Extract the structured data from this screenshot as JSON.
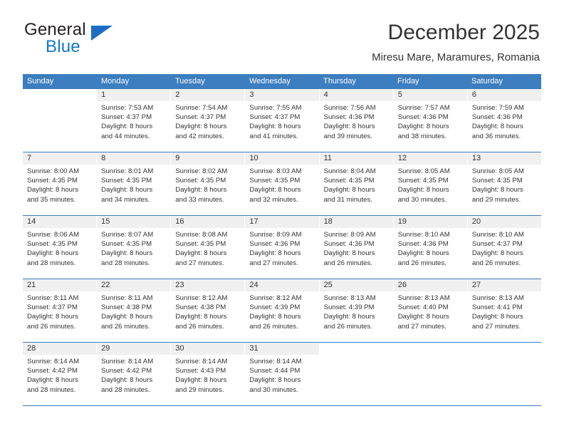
{
  "brand": {
    "line1": "General",
    "line2": "Blue",
    "triangle_icon": "triangle-icon",
    "accent_color": "#1b6ec2"
  },
  "header": {
    "title": "December 2025",
    "subtitle": "Miresu Mare, Maramures, Romania"
  },
  "calendar": {
    "header_color": "#3c7ebf",
    "daynum_bg": "#f0f0f0",
    "day_headers": [
      "Sunday",
      "Monday",
      "Tuesday",
      "Wednesday",
      "Thursday",
      "Friday",
      "Saturday"
    ],
    "weeks": [
      [
        {
          "day": "",
          "lines": []
        },
        {
          "day": "1",
          "lines": [
            "Sunrise: 7:53 AM",
            "Sunset: 4:37 PM",
            "Daylight: 8 hours",
            "and 44 minutes."
          ]
        },
        {
          "day": "2",
          "lines": [
            "Sunrise: 7:54 AM",
            "Sunset: 4:37 PM",
            "Daylight: 8 hours",
            "and 42 minutes."
          ]
        },
        {
          "day": "3",
          "lines": [
            "Sunrise: 7:55 AM",
            "Sunset: 4:37 PM",
            "Daylight: 8 hours",
            "and 41 minutes."
          ]
        },
        {
          "day": "4",
          "lines": [
            "Sunrise: 7:56 AM",
            "Sunset: 4:36 PM",
            "Daylight: 8 hours",
            "and 39 minutes."
          ]
        },
        {
          "day": "5",
          "lines": [
            "Sunrise: 7:57 AM",
            "Sunset: 4:36 PM",
            "Daylight: 8 hours",
            "and 38 minutes."
          ]
        },
        {
          "day": "6",
          "lines": [
            "Sunrise: 7:59 AM",
            "Sunset: 4:36 PM",
            "Daylight: 8 hours",
            "and 36 minutes."
          ]
        }
      ],
      [
        {
          "day": "7",
          "lines": [
            "Sunrise: 8:00 AM",
            "Sunset: 4:35 PM",
            "Daylight: 8 hours",
            "and 35 minutes."
          ]
        },
        {
          "day": "8",
          "lines": [
            "Sunrise: 8:01 AM",
            "Sunset: 4:35 PM",
            "Daylight: 8 hours",
            "and 34 minutes."
          ]
        },
        {
          "day": "9",
          "lines": [
            "Sunrise: 8:02 AM",
            "Sunset: 4:35 PM",
            "Daylight: 8 hours",
            "and 33 minutes."
          ]
        },
        {
          "day": "10",
          "lines": [
            "Sunrise: 8:03 AM",
            "Sunset: 4:35 PM",
            "Daylight: 8 hours",
            "and 32 minutes."
          ]
        },
        {
          "day": "11",
          "lines": [
            "Sunrise: 8:04 AM",
            "Sunset: 4:35 PM",
            "Daylight: 8 hours",
            "and 31 minutes."
          ]
        },
        {
          "day": "12",
          "lines": [
            "Sunrise: 8:05 AM",
            "Sunset: 4:35 PM",
            "Daylight: 8 hours",
            "and 30 minutes."
          ]
        },
        {
          "day": "13",
          "lines": [
            "Sunrise: 8:05 AM",
            "Sunset: 4:35 PM",
            "Daylight: 8 hours",
            "and 29 minutes."
          ]
        }
      ],
      [
        {
          "day": "14",
          "lines": [
            "Sunrise: 8:06 AM",
            "Sunset: 4:35 PM",
            "Daylight: 8 hours",
            "and 28 minutes."
          ]
        },
        {
          "day": "15",
          "lines": [
            "Sunrise: 8:07 AM",
            "Sunset: 4:35 PM",
            "Daylight: 8 hours",
            "and 28 minutes."
          ]
        },
        {
          "day": "16",
          "lines": [
            "Sunrise: 8:08 AM",
            "Sunset: 4:35 PM",
            "Daylight: 8 hours",
            "and 27 minutes."
          ]
        },
        {
          "day": "17",
          "lines": [
            "Sunrise: 8:09 AM",
            "Sunset: 4:36 PM",
            "Daylight: 8 hours",
            "and 27 minutes."
          ]
        },
        {
          "day": "18",
          "lines": [
            "Sunrise: 8:09 AM",
            "Sunset: 4:36 PM",
            "Daylight: 8 hours",
            "and 26 minutes."
          ]
        },
        {
          "day": "19",
          "lines": [
            "Sunrise: 8:10 AM",
            "Sunset: 4:36 PM",
            "Daylight: 8 hours",
            "and 26 minutes."
          ]
        },
        {
          "day": "20",
          "lines": [
            "Sunrise: 8:10 AM",
            "Sunset: 4:37 PM",
            "Daylight: 8 hours",
            "and 26 minutes."
          ]
        }
      ],
      [
        {
          "day": "21",
          "lines": [
            "Sunrise: 8:11 AM",
            "Sunset: 4:37 PM",
            "Daylight: 8 hours",
            "and 26 minutes."
          ]
        },
        {
          "day": "22",
          "lines": [
            "Sunrise: 8:11 AM",
            "Sunset: 4:38 PM",
            "Daylight: 8 hours",
            "and 26 minutes."
          ]
        },
        {
          "day": "23",
          "lines": [
            "Sunrise: 8:12 AM",
            "Sunset: 4:38 PM",
            "Daylight: 8 hours",
            "and 26 minutes."
          ]
        },
        {
          "day": "24",
          "lines": [
            "Sunrise: 8:12 AM",
            "Sunset: 4:39 PM",
            "Daylight: 8 hours",
            "and 26 minutes."
          ]
        },
        {
          "day": "25",
          "lines": [
            "Sunrise: 8:13 AM",
            "Sunset: 4:39 PM",
            "Daylight: 8 hours",
            "and 26 minutes."
          ]
        },
        {
          "day": "26",
          "lines": [
            "Sunrise: 8:13 AM",
            "Sunset: 4:40 PM",
            "Daylight: 8 hours",
            "and 27 minutes."
          ]
        },
        {
          "day": "27",
          "lines": [
            "Sunrise: 8:13 AM",
            "Sunset: 4:41 PM",
            "Daylight: 8 hours",
            "and 27 minutes."
          ]
        }
      ],
      [
        {
          "day": "28",
          "lines": [
            "Sunrise: 8:14 AM",
            "Sunset: 4:42 PM",
            "Daylight: 8 hours",
            "and 28 minutes."
          ]
        },
        {
          "day": "29",
          "lines": [
            "Sunrise: 8:14 AM",
            "Sunset: 4:42 PM",
            "Daylight: 8 hours",
            "and 28 minutes."
          ]
        },
        {
          "day": "30",
          "lines": [
            "Sunrise: 8:14 AM",
            "Sunset: 4:43 PM",
            "Daylight: 8 hours",
            "and 29 minutes."
          ]
        },
        {
          "day": "31",
          "lines": [
            "Sunrise: 8:14 AM",
            "Sunset: 4:44 PM",
            "Daylight: 8 hours",
            "and 30 minutes."
          ]
        },
        {
          "day": "",
          "lines": []
        },
        {
          "day": "",
          "lines": []
        },
        {
          "day": "",
          "lines": []
        }
      ]
    ]
  }
}
